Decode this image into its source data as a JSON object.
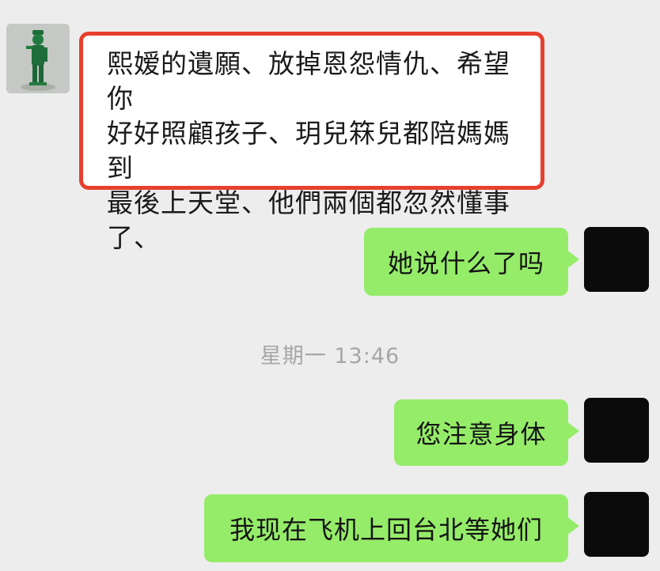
{
  "messages": {
    "incoming": {
      "line1": "熙嫒的遺願、放掉恩怨情仇、希望你",
      "line2": "好好照顧孩子、玥兒箖兒都陪媽媽到",
      "line3": "最後上天堂、他們兩個都忽然懂事",
      "line4": "了、"
    },
    "outgoing_1": "她说什么了吗",
    "timestamp": "星期一 13:46",
    "outgoing_2": "您注意身体",
    "outgoing_3": "我现在飞机上回台北等她们"
  },
  "icons": {
    "left_avatar": "soldier-figure-avatar-icon",
    "right_avatar": "black-avatar-icon"
  },
  "colors": {
    "incoming_bubble": "#ffffff",
    "highlight_border": "#e8402f",
    "outgoing_bubble": "#95ec69",
    "background": "#ededed",
    "timestamp_text": "#a6a6a6"
  }
}
